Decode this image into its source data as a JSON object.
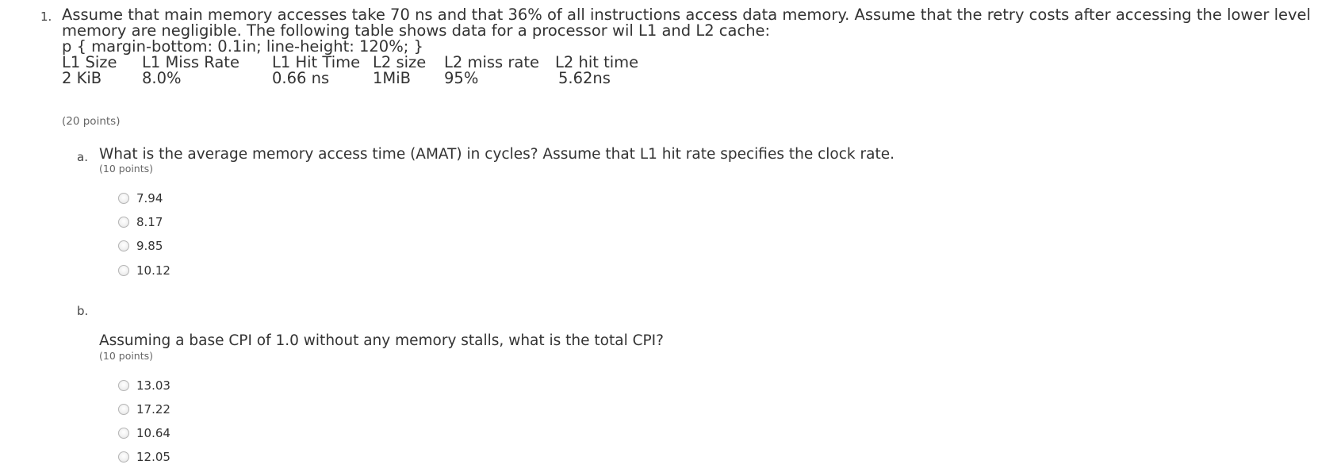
{
  "question": {
    "number": "1.",
    "line1": "Assume that main memory accesses take 70 ns and that 36% of all instructions access data memory. Assume that the retry costs after accessing the lower level",
    "line2": "memory are negligible. The following table shows data for a processor wil L1 and L2 cache:",
    "css_text": "p { margin-bottom: 0.1in; line-height: 120%; }",
    "table": {
      "headers": [
        "L1 Size",
        "L1 Miss Rate",
        "L1 Hit Time",
        "L2 size",
        "L2 miss rate",
        "L2 hit time"
      ],
      "row": [
        "2 KiB",
        "8.0%",
        "0.66 ns",
        "1MiB",
        "95%",
        "5.62ns"
      ]
    },
    "points": "(20 points)"
  },
  "parts": [
    {
      "letter": "a.",
      "text": "What is the average memory access time (AMAT) in cycles? Assume that L1 hit rate specifies the clock rate.",
      "points": "(10 points)",
      "options": [
        "7.94",
        "8.17",
        "9.85",
        "10.12"
      ]
    },
    {
      "letter": "b.",
      "text": "Assuming a base CPI of 1.0 without any memory stalls, what is the total CPI?",
      "points": "(10 points)",
      "options": [
        "13.03",
        "17.22",
        "10.64",
        "12.05"
      ]
    }
  ]
}
